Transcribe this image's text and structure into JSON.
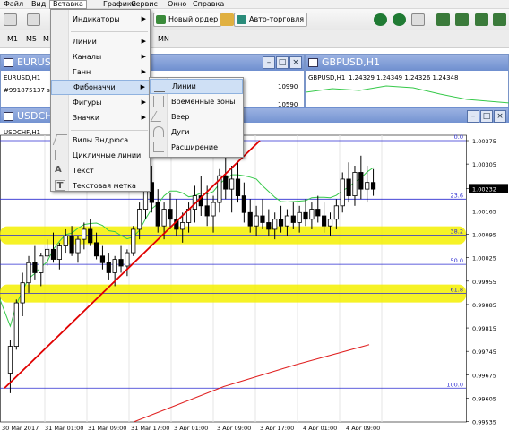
{
  "menubar": [
    "Файл",
    "Вид",
    "Вставка",
    "Графики",
    "Сервис",
    "Окно",
    "Справка"
  ],
  "toolbar": {
    "new_order": "Новый ордер",
    "autotrade": "Авто-торговля"
  },
  "timeframes": [
    "M1",
    "M5",
    "M",
    "MN"
  ],
  "windows": {
    "eurusd": {
      "title": "EURUSD",
      "symbol": "EURUSD,H1",
      "comment": "#991875137 sell"
    },
    "gbpusd": {
      "title": "GBPUSD,H1",
      "symbol": "GBPUSD,H1",
      "quote": "1.24329 1.24349 1.24326 1.24348",
      "levels": [
        "10990",
        "10590"
      ]
    },
    "usdchf": {
      "title": "USDCHF",
      "symbol": "USDCHF,H1"
    }
  },
  "insert_menu": {
    "items": [
      "Индикаторы",
      "Линии",
      "Каналы",
      "Ганн",
      "Фибоначчи",
      "Фигуры",
      "Значки",
      "Вилы Эндрюса",
      "Цикличные линии",
      "Текст",
      "Текстовая метка"
    ],
    "highlighted": "Фибоначчи"
  },
  "fibo_submenu": {
    "items": [
      "Линии",
      "Временные зоны",
      "Веер",
      "Дуги",
      "Расширение"
    ],
    "highlighted": "Линии"
  },
  "chart_data": {
    "type": "candlestick",
    "symbol": "USDCHF,H1",
    "ylim": [
      0.9955,
      1.00375
    ],
    "price_labels": [
      "1.00375",
      "1.00305",
      "1.00232",
      "1.00165",
      "1.00095",
      "1.00025",
      "0.99955",
      "0.99885",
      "0.99815",
      "0.99745",
      "0.99675",
      "0.99605",
      "0.99535"
    ],
    "current_price": "1.00232",
    "time_labels": [
      "30 Mar 2017",
      "31 Mar 01:00",
      "31 Mar 09:00",
      "31 Mar 17:00",
      "3 Apr 01:00",
      "3 Apr 09:00",
      "3 Apr 17:00",
      "4 Apr 01:00",
      "4 Apr 09:00"
    ],
    "fibonacci": {
      "levels": [
        {
          "label": "0.0",
          "price": 1.00375
        },
        {
          "label": "23.6",
          "price": 1.002
        },
        {
          "label": "38.2",
          "price": 1.00092
        },
        {
          "label": "50.0",
          "price": 1.00005
        },
        {
          "label": "61.8",
          "price": 0.99918
        },
        {
          "label": "100.0",
          "price": 0.99635
        }
      ],
      "highlighted": [
        "38.2",
        "61.8"
      ]
    },
    "trendline": {
      "from": [
        0.99635
      ],
      "to": [
        1.00375
      ]
    },
    "candles": [
      {
        "o": 0.9968,
        "h": 0.9978,
        "l": 0.9962,
        "c": 0.9976
      },
      {
        "o": 0.9976,
        "h": 0.999,
        "l": 0.9975,
        "c": 0.9989
      },
      {
        "o": 0.9989,
        "h": 0.9998,
        "l": 0.9985,
        "c": 0.9995
      },
      {
        "o": 0.9995,
        "h": 1.0003,
        "l": 0.9992,
        "c": 1.0001
      },
      {
        "o": 1.0001,
        "h": 1.0006,
        "l": 0.9996,
        "c": 0.9998
      },
      {
        "o": 0.9998,
        "h": 1.0004,
        "l": 0.9994,
        "c": 1.0003
      },
      {
        "o": 1.0003,
        "h": 1.0008,
        "l": 1.0,
        "c": 1.0005
      },
      {
        "o": 1.0005,
        "h": 1.001,
        "l": 1.0001,
        "c": 1.0002
      },
      {
        "o": 1.0002,
        "h": 1.0007,
        "l": 0.9999,
        "c": 1.0006
      },
      {
        "o": 1.0006,
        "h": 1.0011,
        "l": 1.0004,
        "c": 1.0009
      },
      {
        "o": 1.0009,
        "h": 1.0012,
        "l": 1.0003,
        "c": 1.0004
      },
      {
        "o": 1.0004,
        "h": 1.0009,
        "l": 1.0001,
        "c": 1.0008
      },
      {
        "o": 1.0008,
        "h": 1.0013,
        "l": 1.0005,
        "c": 1.0011
      },
      {
        "o": 1.0011,
        "h": 1.0014,
        "l": 1.0006,
        "c": 1.0007
      },
      {
        "o": 1.0007,
        "h": 1.001,
        "l": 1.0002,
        "c": 1.0003
      },
      {
        "o": 1.0003,
        "h": 1.0006,
        "l": 0.9999,
        "c": 1.0001
      },
      {
        "o": 1.0001,
        "h": 1.0004,
        "l": 0.9996,
        "c": 0.9998
      },
      {
        "o": 0.9998,
        "h": 1.0003,
        "l": 0.9994,
        "c": 1.0002
      },
      {
        "o": 1.0002,
        "h": 1.0006,
        "l": 0.9998,
        "c": 1.0
      },
      {
        "o": 1.0,
        "h": 1.0005,
        "l": 0.9997,
        "c": 1.0004
      },
      {
        "o": 1.0004,
        "h": 1.0012,
        "l": 1.0003,
        "c": 1.0011
      },
      {
        "o": 1.0011,
        "h": 1.0019,
        "l": 1.0008,
        "c": 1.0017
      },
      {
        "o": 1.0017,
        "h": 1.0027,
        "l": 1.0014,
        "c": 1.0025
      },
      {
        "o": 1.0025,
        "h": 1.003,
        "l": 1.0016,
        "c": 1.0019
      },
      {
        "o": 1.0019,
        "h": 1.0023,
        "l": 1.001,
        "c": 1.0012
      },
      {
        "o": 1.0012,
        "h": 1.0019,
        "l": 1.0008,
        "c": 1.0017
      },
      {
        "o": 1.0017,
        "h": 1.0022,
        "l": 1.0011,
        "c": 1.0014
      },
      {
        "o": 1.0014,
        "h": 1.002,
        "l": 1.0009,
        "c": 1.0011
      },
      {
        "o": 1.0011,
        "h": 1.0016,
        "l": 1.0007,
        "c": 1.0013
      },
      {
        "o": 1.0013,
        "h": 1.0019,
        "l": 1.001,
        "c": 1.0017
      },
      {
        "o": 1.0017,
        "h": 1.0024,
        "l": 1.0013,
        "c": 1.0021
      },
      {
        "o": 1.0021,
        "h": 1.0027,
        "l": 1.0015,
        "c": 1.0018
      },
      {
        "o": 1.0018,
        "h": 1.0024,
        "l": 1.0012,
        "c": 1.0015
      },
      {
        "o": 1.0015,
        "h": 1.0021,
        "l": 1.001,
        "c": 1.0019
      },
      {
        "o": 1.0019,
        "h": 1.0029,
        "l": 1.0016,
        "c": 1.0027
      },
      {
        "o": 1.0027,
        "h": 1.0035,
        "l": 1.002,
        "c": 1.0023
      },
      {
        "o": 1.0023,
        "h": 1.003,
        "l": 1.0016,
        "c": 1.0026
      },
      {
        "o": 1.0026,
        "h": 1.0031,
        "l": 1.0019,
        "c": 1.0021
      },
      {
        "o": 1.0021,
        "h": 1.0025,
        "l": 1.0013,
        "c": 1.0016
      },
      {
        "o": 1.0016,
        "h": 1.002,
        "l": 1.001,
        "c": 1.0012
      },
      {
        "o": 1.0012,
        "h": 1.0018,
        "l": 1.0009,
        "c": 1.0015
      },
      {
        "o": 1.0015,
        "h": 1.002,
        "l": 1.0011,
        "c": 1.0013
      },
      {
        "o": 1.0013,
        "h": 1.0017,
        "l": 1.0009,
        "c": 1.0011
      },
      {
        "o": 1.0011,
        "h": 1.0016,
        "l": 1.0008,
        "c": 1.0014
      },
      {
        "o": 1.0014,
        "h": 1.0018,
        "l": 1.001,
        "c": 1.0012
      },
      {
        "o": 1.0012,
        "h": 1.0017,
        "l": 1.0009,
        "c": 1.0015
      },
      {
        "o": 1.0015,
        "h": 1.0019,
        "l": 1.0011,
        "c": 1.0013
      },
      {
        "o": 1.0013,
        "h": 1.0018,
        "l": 1.001,
        "c": 1.0016
      },
      {
        "o": 1.0016,
        "h": 1.002,
        "l": 1.0012,
        "c": 1.0014
      },
      {
        "o": 1.0014,
        "h": 1.0019,
        "l": 1.0011,
        "c": 1.0017
      },
      {
        "o": 1.0017,
        "h": 1.0021,
        "l": 1.0013,
        "c": 1.0015
      },
      {
        "o": 1.0015,
        "h": 1.0019,
        "l": 1.001,
        "c": 1.0012
      },
      {
        "o": 1.0012,
        "h": 1.0016,
        "l": 1.0009,
        "c": 1.0014
      },
      {
        "o": 1.0014,
        "h": 1.002,
        "l": 1.0011,
        "c": 1.0018
      },
      {
        "o": 1.0018,
        "h": 1.0028,
        "l": 1.0016,
        "c": 1.0026
      },
      {
        "o": 1.0026,
        "h": 1.0031,
        "l": 1.0019,
        "c": 1.0021
      },
      {
        "o": 1.0021,
        "h": 1.003,
        "l": 1.0018,
        "c": 1.0028
      },
      {
        "o": 1.0028,
        "h": 1.0033,
        "l": 1.002,
        "c": 1.0023
      },
      {
        "o": 1.0023,
        "h": 1.003,
        "l": 1.0019,
        "c": 1.0025
      },
      {
        "o": 1.0025,
        "h": 1.0029,
        "l": 1.0021,
        "c": 1.0023
      }
    ]
  },
  "colors": {
    "fib_line": "#2b2bd0",
    "trendline": "#e00000",
    "highlight": "#f5f000",
    "ma_green": "#36c94a",
    "ma_red": "#e02020"
  }
}
